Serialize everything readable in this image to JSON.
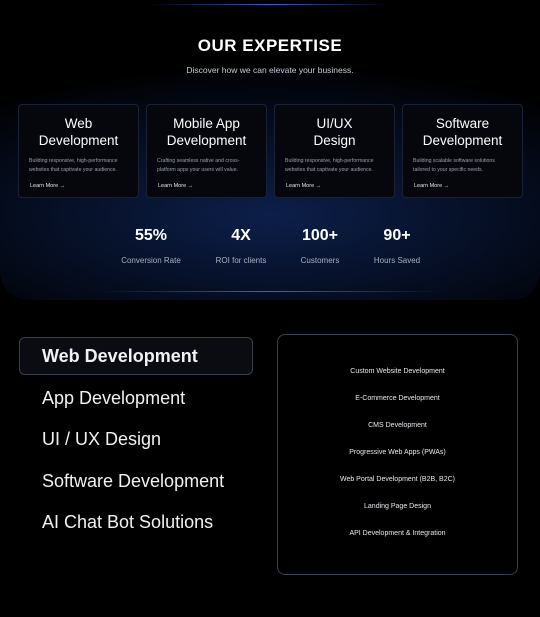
{
  "header": {
    "title": "OUR  EXPERTISE",
    "subtitle": "Discover how we can elevate your business."
  },
  "cards": [
    {
      "title_line1": "Web",
      "title_line2": "Development",
      "desc_line1": "Building responsive, high-performance",
      "desc_line2": "websites that captivate your audience.",
      "link": "Learn More →"
    },
    {
      "title_line1": "Mobile App",
      "title_line2": "Development",
      "desc_line1": "Crafting seamless native and cross-",
      "desc_line2": "platform apps your users will value.",
      "link": "Learn More →"
    },
    {
      "title_line1": "UI/UX",
      "title_line2": "Design",
      "desc_line1": "Building responsive, high-performance",
      "desc_line2": "websites that captivate your audience.",
      "link": "Learn More →"
    },
    {
      "title_line1": "Software",
      "title_line2": "Development",
      "desc_line1": "Building scalable software solutions",
      "desc_line2": "tailored to your specific needs.",
      "link": "Learn More →"
    }
  ],
  "stats": [
    {
      "value": "55%",
      "label": "Conversion Rate"
    },
    {
      "value": "4X",
      "label": "ROI for clients"
    },
    {
      "value": "100+",
      "label": "Customers"
    },
    {
      "value": "90+",
      "label": "Hours Saved"
    }
  ],
  "services": {
    "items": [
      {
        "label": "Web Development",
        "active": true
      },
      {
        "label": "App Development",
        "active": false
      },
      {
        "label": "UI / UX Design",
        "active": false
      },
      {
        "label": "Software Development",
        "active": false
      },
      {
        "label": "AI Chat Bot Solutions",
        "active": false
      }
    ]
  },
  "details": {
    "items": [
      "Custom Website Development",
      "E-Commerce Development",
      "CMS Development",
      "Progressive Web Apps (PWAs)",
      "Web Portal Development (B2B, B2C)",
      "Landing Page Design",
      "API Development & Integration"
    ]
  },
  "colors": {
    "background": "#000000",
    "panel_border": "#3a4050",
    "accent_glow": "#0d1f4a"
  }
}
